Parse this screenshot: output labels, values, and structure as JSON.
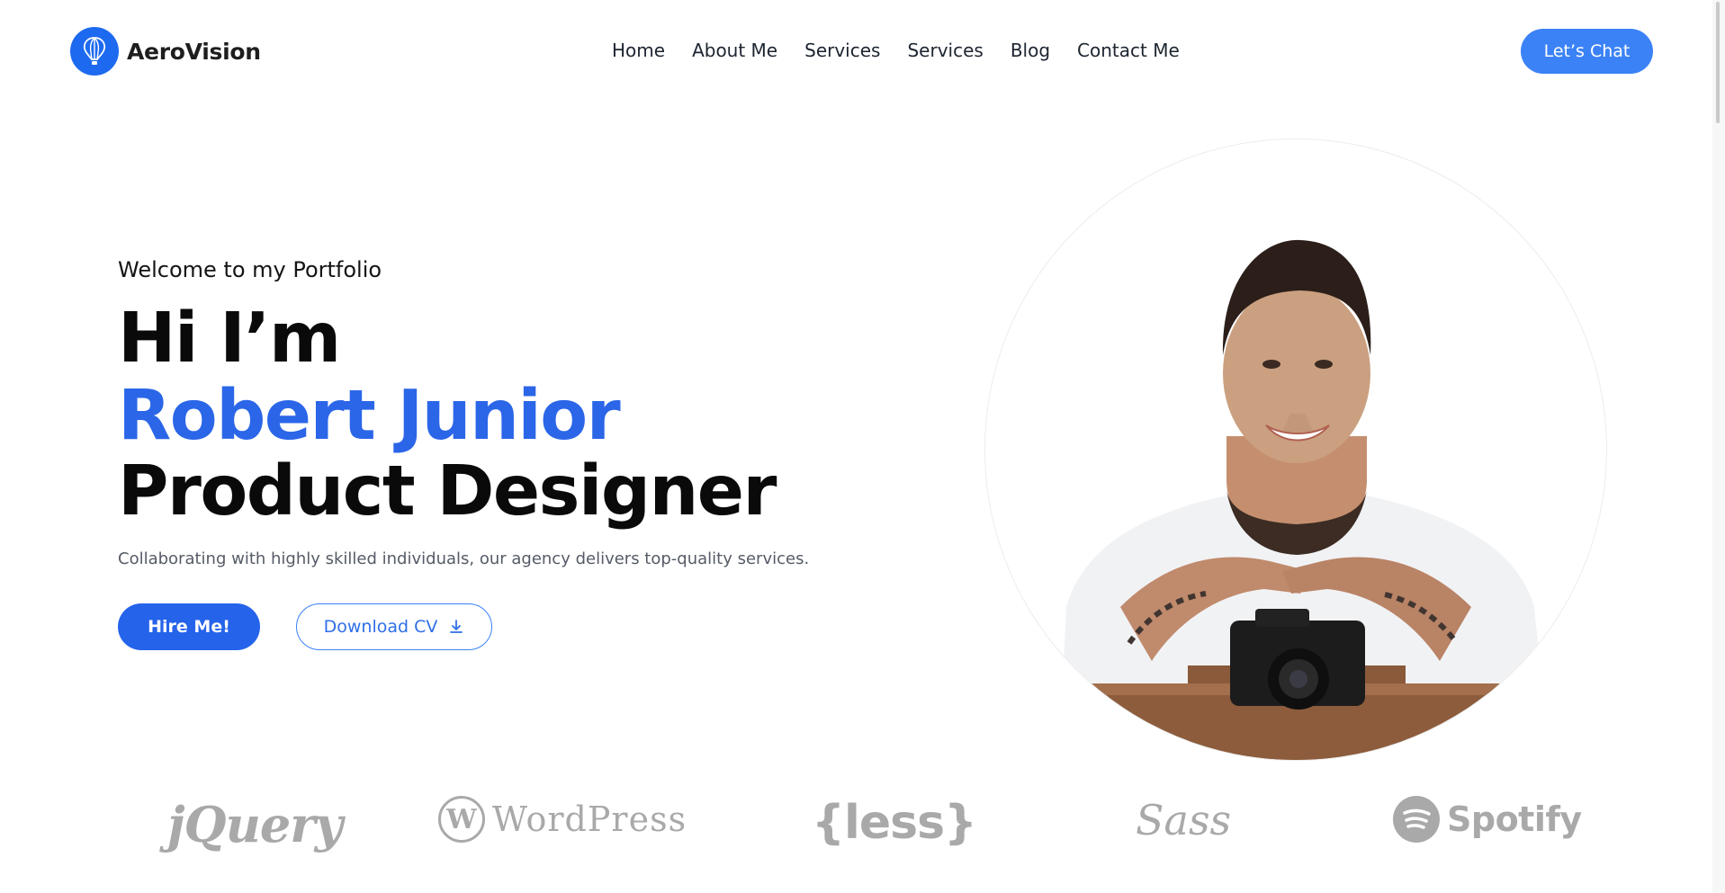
{
  "header": {
    "logo_text": "AeroVision",
    "logo_icon": "hot-air-balloon-icon",
    "nav": [
      "Home",
      "About Me",
      "Services",
      "Services",
      "Blog",
      "Contact Me"
    ],
    "cta_label": "Let’s Chat"
  },
  "hero": {
    "eyebrow": "Welcome to my Portfolio",
    "line1": "Hi I’m",
    "line2": "Robert Junior",
    "line3": "Product Designer",
    "description": "Collaborating with highly skilled individuals, our agency delivers top-quality services.",
    "hire_label": "Hire Me!",
    "cv_label": "Download CV",
    "cv_icon": "download-icon",
    "portrait_alt": "portrait-photo"
  },
  "brands": [
    {
      "name": "jQuery",
      "icon": "jquery-logo"
    },
    {
      "name": "WordPress",
      "icon": "wordpress-logo"
    },
    {
      "name": "{less}",
      "icon": "less-logo"
    },
    {
      "name": "Sass",
      "icon": "sass-logo"
    },
    {
      "name": "Spotify",
      "icon": "spotify-logo"
    }
  ],
  "colors": {
    "accent": "#2563eb",
    "accent_light": "#3b82f6",
    "text": "#0a0a0a",
    "muted": "#555b66",
    "brand_gray": "#a9a9a9"
  }
}
